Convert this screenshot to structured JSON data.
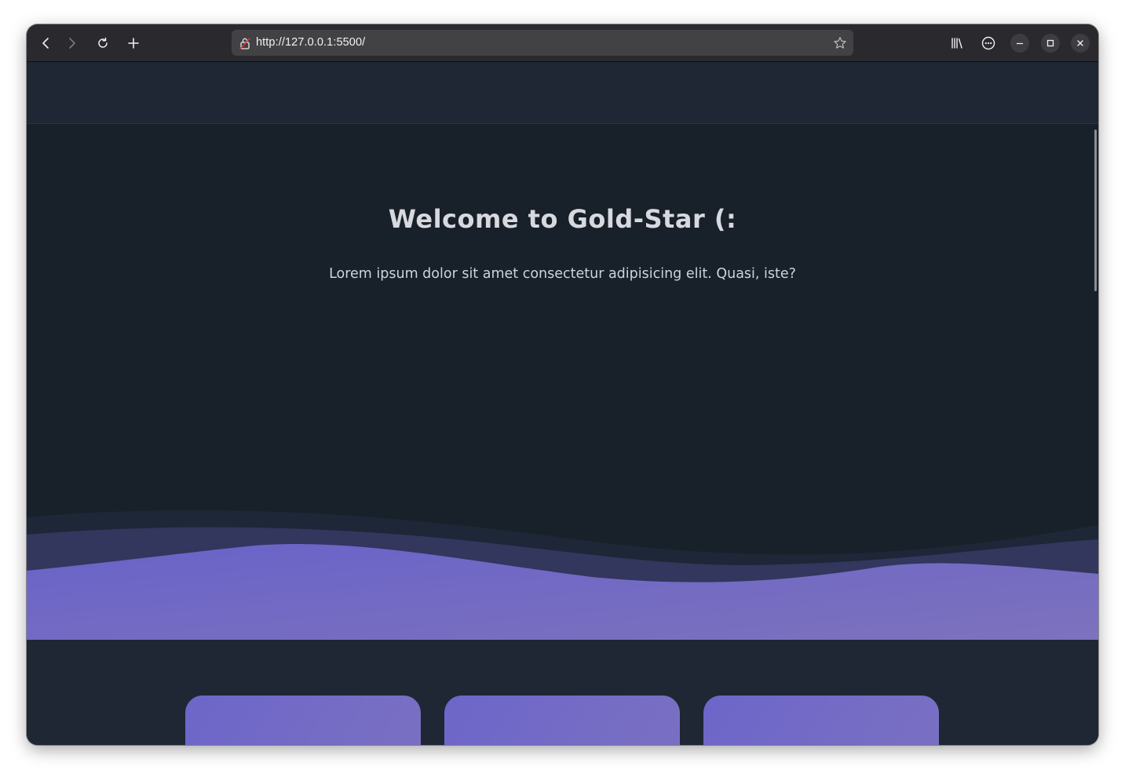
{
  "browser": {
    "url": "http://127.0.0.1:5500/",
    "icons": {
      "back": "back-arrow-icon",
      "forward": "forward-arrow-icon",
      "reload": "reload-icon",
      "new_tab": "plus-icon",
      "security": "insecure-lock-icon",
      "bookmark": "star-icon",
      "library": "library-icon",
      "menu": "ellipsis-circle-icon",
      "minimize": "minimize-icon",
      "maximize": "maximize-icon",
      "close": "close-icon"
    }
  },
  "hero": {
    "title": "Welcome to Gold-Star (:",
    "subtitle": "Lorem ipsum dolor sit amet consectetur adipisicing elit. Quasi, iste?"
  },
  "colors": {
    "header_bg": "#1e2733",
    "hero_bg": "#18202a",
    "accent": "#6d66c9",
    "title_text": "#d8d9de"
  },
  "cards": [
    {
      "label": ""
    },
    {
      "label": ""
    },
    {
      "label": ""
    }
  ]
}
